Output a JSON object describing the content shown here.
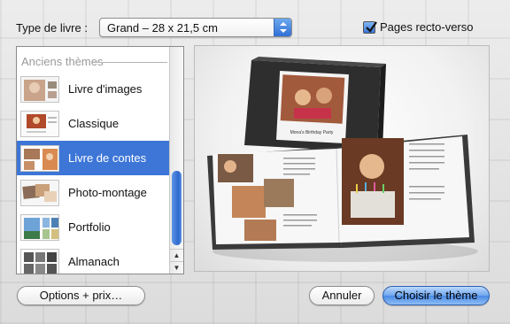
{
  "header": {
    "type_label": "Type de livre :",
    "size_select": {
      "value": "Grand – 28 x 21,5 cm"
    },
    "recto_verso": {
      "label": "Pages recto-verso",
      "checked": true
    }
  },
  "theme_list": {
    "section_header": "Anciens thèmes",
    "items": [
      {
        "label": "Livre d'images",
        "selected": false
      },
      {
        "label": "Classique",
        "selected": false
      },
      {
        "label": "Livre de contes",
        "selected": true
      },
      {
        "label": "Photo-montage",
        "selected": false
      },
      {
        "label": "Portfolio",
        "selected": false
      },
      {
        "label": "Almanach",
        "selected": false
      }
    ]
  },
  "preview": {
    "cover_caption": "Mona's Birthday Party"
  },
  "buttons": {
    "options": "Options + prix…",
    "cancel": "Annuler",
    "choose": "Choisir le thème"
  },
  "colors": {
    "selection": "#3d76d7",
    "default_button": "#4a8ae6"
  }
}
